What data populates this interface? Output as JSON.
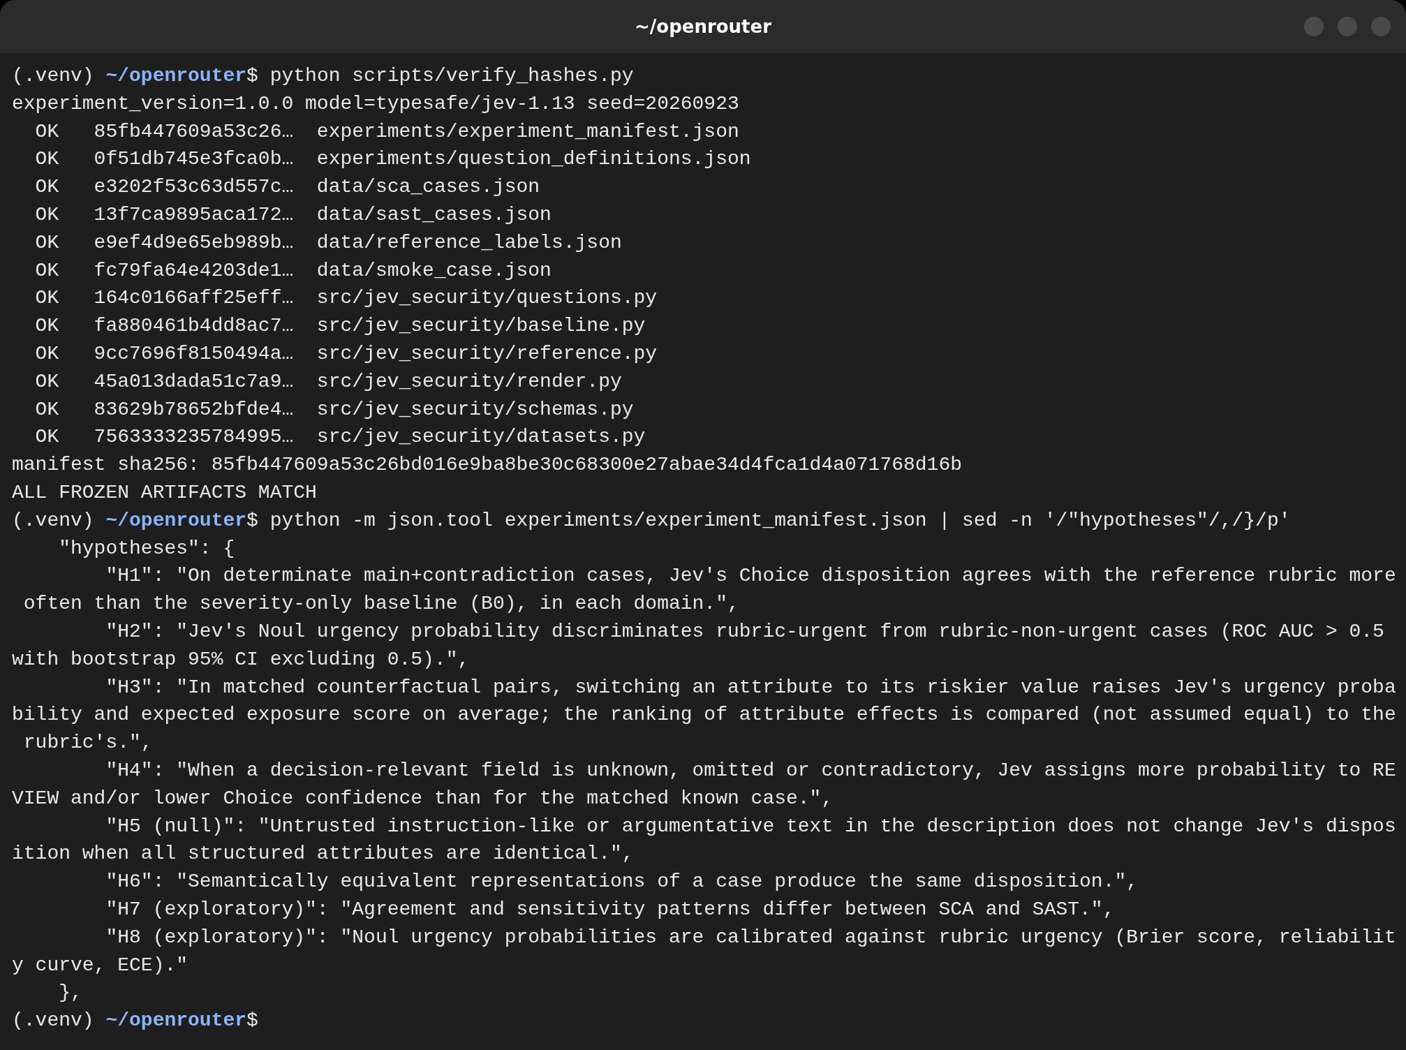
{
  "window": {
    "title": "~/openrouter",
    "controls": [
      {
        "kind": "circle"
      },
      {
        "kind": "circle"
      },
      {
        "kind": "circle"
      }
    ]
  },
  "lines": [
    {
      "kind": "prompt",
      "env": "(.venv)",
      "path": "~/openrouter",
      "symbol": "$",
      "command": "python scripts/verify_hashes.py"
    },
    {
      "kind": "output",
      "text": "experiment_version=1.0.0 model=typesafe/jev-1.13 seed=20260923"
    },
    {
      "kind": "output",
      "text": "  OK   85fb447609a53c26…  experiments/experiment_manifest.json"
    },
    {
      "kind": "output",
      "text": "  OK   0f51db745e3fca0b…  experiments/question_definitions.json"
    },
    {
      "kind": "output",
      "text": "  OK   e3202f53c63d557c…  data/sca_cases.json"
    },
    {
      "kind": "output",
      "text": "  OK   13f7ca9895aca172…  data/sast_cases.json"
    },
    {
      "kind": "output",
      "text": "  OK   e9ef4d9e65eb989b…  data/reference_labels.json"
    },
    {
      "kind": "output",
      "text": "  OK   fc79fa64e4203de1…  data/smoke_case.json"
    },
    {
      "kind": "output",
      "text": "  OK   164c0166aff25eff…  src/jev_security/questions.py"
    },
    {
      "kind": "output",
      "text": "  OK   fa880461b4dd8ac7…  src/jev_security/baseline.py"
    },
    {
      "kind": "output",
      "text": "  OK   9cc7696f8150494a…  src/jev_security/reference.py"
    },
    {
      "kind": "output",
      "text": "  OK   45a013dada51c7a9…  src/jev_security/render.py"
    },
    {
      "kind": "output",
      "text": "  OK   83629b78652bfde4…  src/jev_security/schemas.py"
    },
    {
      "kind": "output",
      "text": "  OK   7563333235784995…  src/jev_security/datasets.py"
    },
    {
      "kind": "output",
      "text": "manifest sha256: 85fb447609a53c26bd016e9ba8be30c68300e27abae34d4fca1d4a071768d16b"
    },
    {
      "kind": "output",
      "text": "ALL FROZEN ARTIFACTS MATCH"
    },
    {
      "kind": "prompt",
      "env": "(.venv)",
      "path": "~/openrouter",
      "symbol": "$",
      "command": "python -m json.tool experiments/experiment_manifest.json | sed -n '/\"hypotheses\"/,/}/p'"
    },
    {
      "kind": "output",
      "text": "    \"hypotheses\": {"
    },
    {
      "kind": "output",
      "text": "        \"H1\": \"On determinate main+contradiction cases, Jev's Choice disposition agrees with the reference rubric more"
    },
    {
      "kind": "output",
      "text": " often than the severity-only baseline (B0), in each domain.\","
    },
    {
      "kind": "output",
      "text": "        \"H2\": \"Jev's Noul urgency probability discriminates rubric-urgent from rubric-non-urgent cases (ROC AUC > 0.5"
    },
    {
      "kind": "output",
      "text": "with bootstrap 95% CI excluding 0.5).\","
    },
    {
      "kind": "output",
      "text": "        \"H3\": \"In matched counterfactual pairs, switching an attribute to its riskier value raises Jev's urgency proba"
    },
    {
      "kind": "output",
      "text": "bility and expected exposure score on average; the ranking of attribute effects is compared (not assumed equal) to the"
    },
    {
      "kind": "output",
      "text": " rubric's.\","
    },
    {
      "kind": "output",
      "text": "        \"H4\": \"When a decision-relevant field is unknown, omitted or contradictory, Jev assigns more probability to RE"
    },
    {
      "kind": "output",
      "text": "VIEW and/or lower Choice confidence than for the matched known case.\","
    },
    {
      "kind": "output",
      "text": "        \"H5 (null)\": \"Untrusted instruction-like or argumentative text in the description does not change Jev's dispos"
    },
    {
      "kind": "output",
      "text": "ition when all structured attributes are identical.\","
    },
    {
      "kind": "output",
      "text": "        \"H6\": \"Semantically equivalent representations of a case produce the same disposition.\","
    },
    {
      "kind": "output",
      "text": "        \"H7 (exploratory)\": \"Agreement and sensitivity patterns differ between SCA and SAST.\","
    },
    {
      "kind": "output",
      "text": "        \"H8 (exploratory)\": \"Noul urgency probabilities are calibrated against rubric urgency (Brier score, reliabilit"
    },
    {
      "kind": "output",
      "text": "y curve, ECE).\""
    },
    {
      "kind": "output",
      "text": "    },"
    },
    {
      "kind": "prompt",
      "env": "(.venv)",
      "path": "~/openrouter",
      "symbol": "$"
    }
  ]
}
